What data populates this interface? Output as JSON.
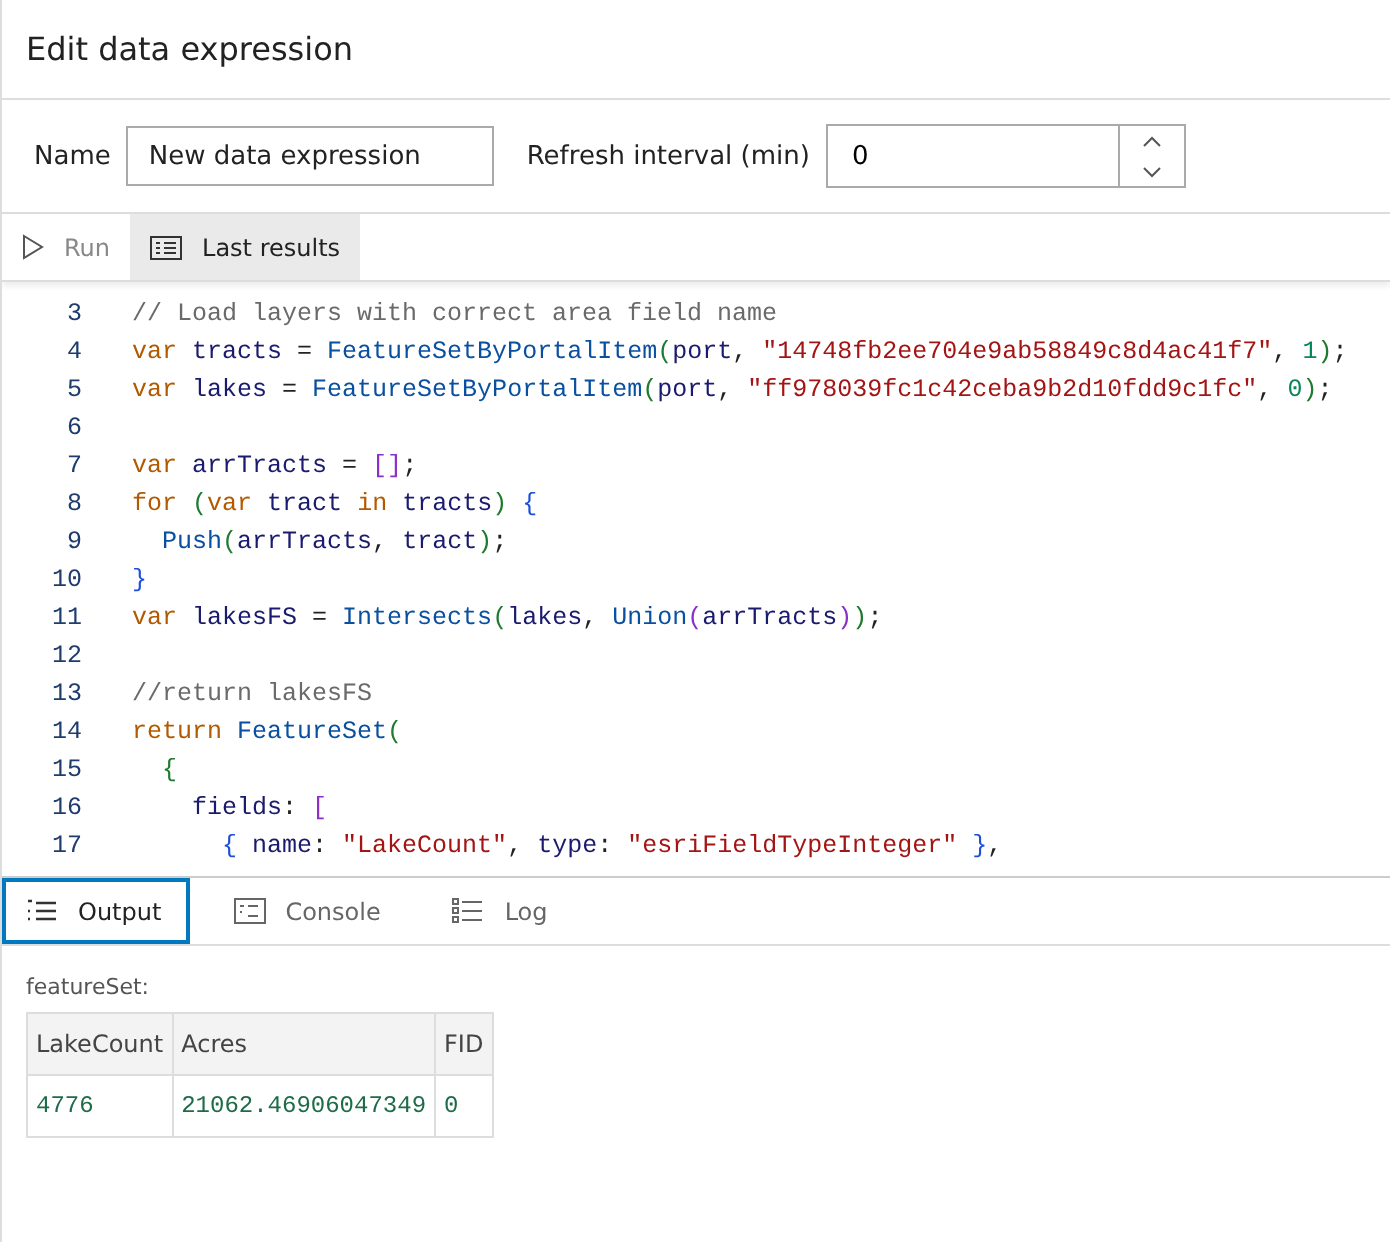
{
  "window": {
    "title": "Edit data expression"
  },
  "form": {
    "name_label": "Name",
    "name_value": "New data expression",
    "refresh_label": "Refresh interval (min)",
    "refresh_value": "0"
  },
  "toolbar": [
    {
      "label": "Run",
      "kind": "run",
      "selected": false,
      "disabled": true
    },
    {
      "label": "Last results",
      "kind": "results",
      "selected": true,
      "disabled": false
    }
  ],
  "code": [
    {
      "number": "3",
      "tokens": [
        {
          "kind": "cm",
          "text": "// Load layers with correct area field name"
        }
      ]
    },
    {
      "number": "4",
      "tokens": [
        {
          "kind": "kw",
          "text": "var"
        },
        {
          "kind": "id",
          "text": " tracts"
        },
        {
          "kind": "p",
          "text": " = "
        },
        {
          "kind": "fn",
          "text": "FeatureSetByPortalItem"
        },
        {
          "kind": "b1",
          "text": "("
        },
        {
          "kind": "id",
          "text": "port"
        },
        {
          "kind": "p",
          "text": ", "
        },
        {
          "kind": "str",
          "text": "\"14748fb2ee704e9ab58849c8d4ac41f7\""
        },
        {
          "kind": "p",
          "text": ", "
        },
        {
          "kind": "num",
          "text": "1"
        },
        {
          "kind": "b1",
          "text": ")"
        },
        {
          "kind": "p",
          "text": ";"
        }
      ]
    },
    {
      "number": "5",
      "tokens": [
        {
          "kind": "kw",
          "text": "var"
        },
        {
          "kind": "id",
          "text": " lakes"
        },
        {
          "kind": "p",
          "text": " = "
        },
        {
          "kind": "fn",
          "text": "FeatureSetByPortalItem"
        },
        {
          "kind": "b1",
          "text": "("
        },
        {
          "kind": "id",
          "text": "port"
        },
        {
          "kind": "p",
          "text": ", "
        },
        {
          "kind": "str",
          "text": "\"ff978039fc1c42ceba9b2d10fdd9c1fc\""
        },
        {
          "kind": "p",
          "text": ", "
        },
        {
          "kind": "num",
          "text": "0"
        },
        {
          "kind": "b1",
          "text": ")"
        },
        {
          "kind": "p",
          "text": ";"
        }
      ]
    },
    {
      "number": "6"
    },
    {
      "number": "7",
      "tokens": [
        {
          "kind": "kw",
          "text": "var"
        },
        {
          "kind": "id",
          "text": " arrTracts"
        },
        {
          "kind": "p",
          "text": " = "
        },
        {
          "kind": "b2",
          "text": "[]"
        },
        {
          "kind": "p",
          "text": ";"
        }
      ]
    },
    {
      "number": "8",
      "tokens": [
        {
          "kind": "kw",
          "text": "for"
        },
        {
          "kind": "b1",
          "text": " ("
        },
        {
          "kind": "kw",
          "text": "var"
        },
        {
          "kind": "id",
          "text": " tract"
        },
        {
          "kind": "kw",
          "text": " in"
        },
        {
          "kind": "id",
          "text": " tracts"
        },
        {
          "kind": "b1",
          "text": ")"
        },
        {
          "kind": "b3",
          "text": " {"
        }
      ]
    },
    {
      "number": "9",
      "tokens": [
        {
          "kind": "fn",
          "text": "  Push"
        },
        {
          "kind": "b1",
          "text": "("
        },
        {
          "kind": "id",
          "text": "arrTracts"
        },
        {
          "kind": "p",
          "text": ", "
        },
        {
          "kind": "id",
          "text": "tract"
        },
        {
          "kind": "b1",
          "text": ")"
        },
        {
          "kind": "p",
          "text": ";"
        }
      ]
    },
    {
      "number": "10",
      "tokens": [
        {
          "kind": "b3",
          "text": "}"
        }
      ]
    },
    {
      "number": "11",
      "tokens": [
        {
          "kind": "kw",
          "text": "var"
        },
        {
          "kind": "id",
          "text": " lakesFS"
        },
        {
          "kind": "p",
          "text": " = "
        },
        {
          "kind": "fn",
          "text": "Intersects"
        },
        {
          "kind": "b1",
          "text": "("
        },
        {
          "kind": "id",
          "text": "lakes"
        },
        {
          "kind": "p",
          "text": ", "
        },
        {
          "kind": "fn",
          "text": "Union"
        },
        {
          "kind": "b2",
          "text": "("
        },
        {
          "kind": "id",
          "text": "arrTracts"
        },
        {
          "kind": "b2",
          "text": ")"
        },
        {
          "kind": "b1",
          "text": ")"
        },
        {
          "kind": "p",
          "text": ";"
        }
      ]
    },
    {
      "number": "12"
    },
    {
      "number": "13",
      "tokens": [
        {
          "kind": "cm",
          "text": "//return lakesFS"
        }
      ]
    },
    {
      "number": "14",
      "tokens": [
        {
          "kind": "kw",
          "text": "return"
        },
        {
          "kind": "fn",
          "text": " FeatureSet"
        },
        {
          "kind": "b1",
          "text": "("
        }
      ]
    },
    {
      "number": "15",
      "tokens": [
        {
          "kind": "b1",
          "text": "  {"
        }
      ]
    },
    {
      "number": "16",
      "tokens": [
        {
          "kind": "id",
          "text": "    fields"
        },
        {
          "kind": "p",
          "text": ": "
        },
        {
          "kind": "b2",
          "text": "["
        }
      ]
    },
    {
      "number": "17",
      "tokens": [
        {
          "kind": "b3",
          "text": "      {"
        },
        {
          "kind": "id",
          "text": " name"
        },
        {
          "kind": "p",
          "text": ": "
        },
        {
          "kind": "str",
          "text": "\"LakeCount\""
        },
        {
          "kind": "p",
          "text": ", "
        },
        {
          "kind": "id",
          "text": "type"
        },
        {
          "kind": "p",
          "text": ": "
        },
        {
          "kind": "str",
          "text": "\"esriFieldTypeInteger\""
        },
        {
          "kind": "b3",
          "text": " }"
        },
        {
          "kind": "p",
          "text": ","
        }
      ]
    }
  ],
  "output_tabs": [
    {
      "label": "Output",
      "kind": "output",
      "selected": true
    },
    {
      "label": "Console",
      "kind": "console",
      "selected": false
    },
    {
      "label": "Log",
      "kind": "log",
      "selected": false
    }
  ],
  "result": {
    "label": "featureSet:",
    "columns": [
      "LakeCount",
      "Acres",
      "FID"
    ],
    "rows": [
      [
        "4776",
        "21062.46906047349",
        "0"
      ]
    ]
  }
}
